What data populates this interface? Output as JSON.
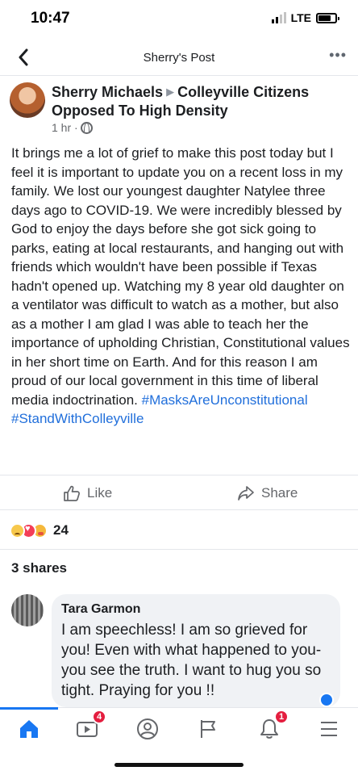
{
  "status_bar": {
    "time": "10:47",
    "network": "LTE"
  },
  "header": {
    "title": "Sherry's Post",
    "back_icon": "chevron-left-icon",
    "more_icon": "ellipsis-icon",
    "more_text": "•••"
  },
  "post": {
    "author": "Sherry Michaels",
    "group": "Colleyville Citizens Opposed To High Density",
    "time": "1 hr ·",
    "body": "It brings me a lot of grief to make this post today but I feel it is important to update you on a recent loss in my family. We lost our youngest daughter Natylee three days ago to COVID-19. We were incredibly blessed by God to enjoy the days before she got sick going to parks, eating at local restaurants, and hanging out with friends which wouldn't have been possible if Texas hadn't opened up. Watching my 8 year old daughter on a ventilator was difficult to watch as a mother, but also as a mother I am glad I was able to teach her the importance of upholding Christian, Constitutional values in her short time on Earth. And for this reason I am proud of our local government in this time of liberal media indoctrination.",
    "hashtags": [
      "#MasksAreUnconstitutional",
      "#StandWithColleyville"
    ]
  },
  "actions": {
    "like_label": "Like",
    "share_label": "Share"
  },
  "reactions": {
    "count": "24",
    "types": [
      "sad",
      "love",
      "care"
    ]
  },
  "shares_label": "3 shares",
  "comment": {
    "name": "Tara Garmon",
    "text": "I am speechless! I am so grieved for you! Even with what happened to you- you see the truth. I want to hug you so tight. Praying for you !!"
  },
  "bottom_nav": {
    "items": [
      {
        "icon": "home-icon",
        "active": true
      },
      {
        "icon": "watch-video-icon",
        "badge": "4"
      },
      {
        "icon": "profile-icon"
      },
      {
        "icon": "pages-flag-icon"
      },
      {
        "icon": "notifications-bell-icon",
        "badge": "1"
      },
      {
        "icon": "menu-icon"
      }
    ]
  },
  "colors": {
    "accent": "#1877f2",
    "hashtag": "#216fdb",
    "badge": "#e41e3f",
    "text": "#1c1e21",
    "muted": "#65676b"
  }
}
